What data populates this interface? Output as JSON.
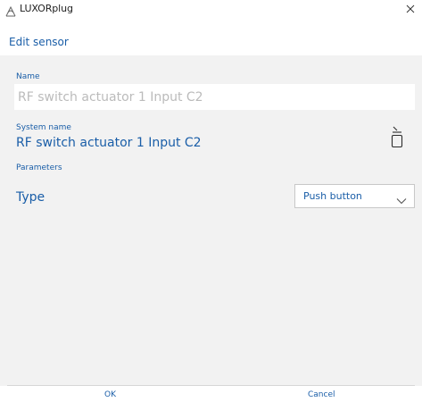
{
  "window": {
    "title": "LUXORplug",
    "close_icon": "close-icon",
    "app_icon": "luxorplug-logo-icon"
  },
  "header": {
    "title": "Edit sensor"
  },
  "form": {
    "name_label": "Name",
    "name_value": "",
    "name_placeholder": "RF switch actuator 1 Input C2",
    "system_name_label": "System name",
    "system_name_value": "RF switch actuator 1 Input C2",
    "sensor_icon": "push-button-sensor-icon",
    "parameters_label": "Parameters",
    "type_label": "Type",
    "type_selected": "Push button"
  },
  "footer": {
    "ok_label": "OK",
    "cancel_label": "Cancel"
  },
  "colors": {
    "accent": "#1a5ea8",
    "background": "#f2f2f2",
    "surface": "#ffffff",
    "placeholder": "#bbbbbb"
  }
}
